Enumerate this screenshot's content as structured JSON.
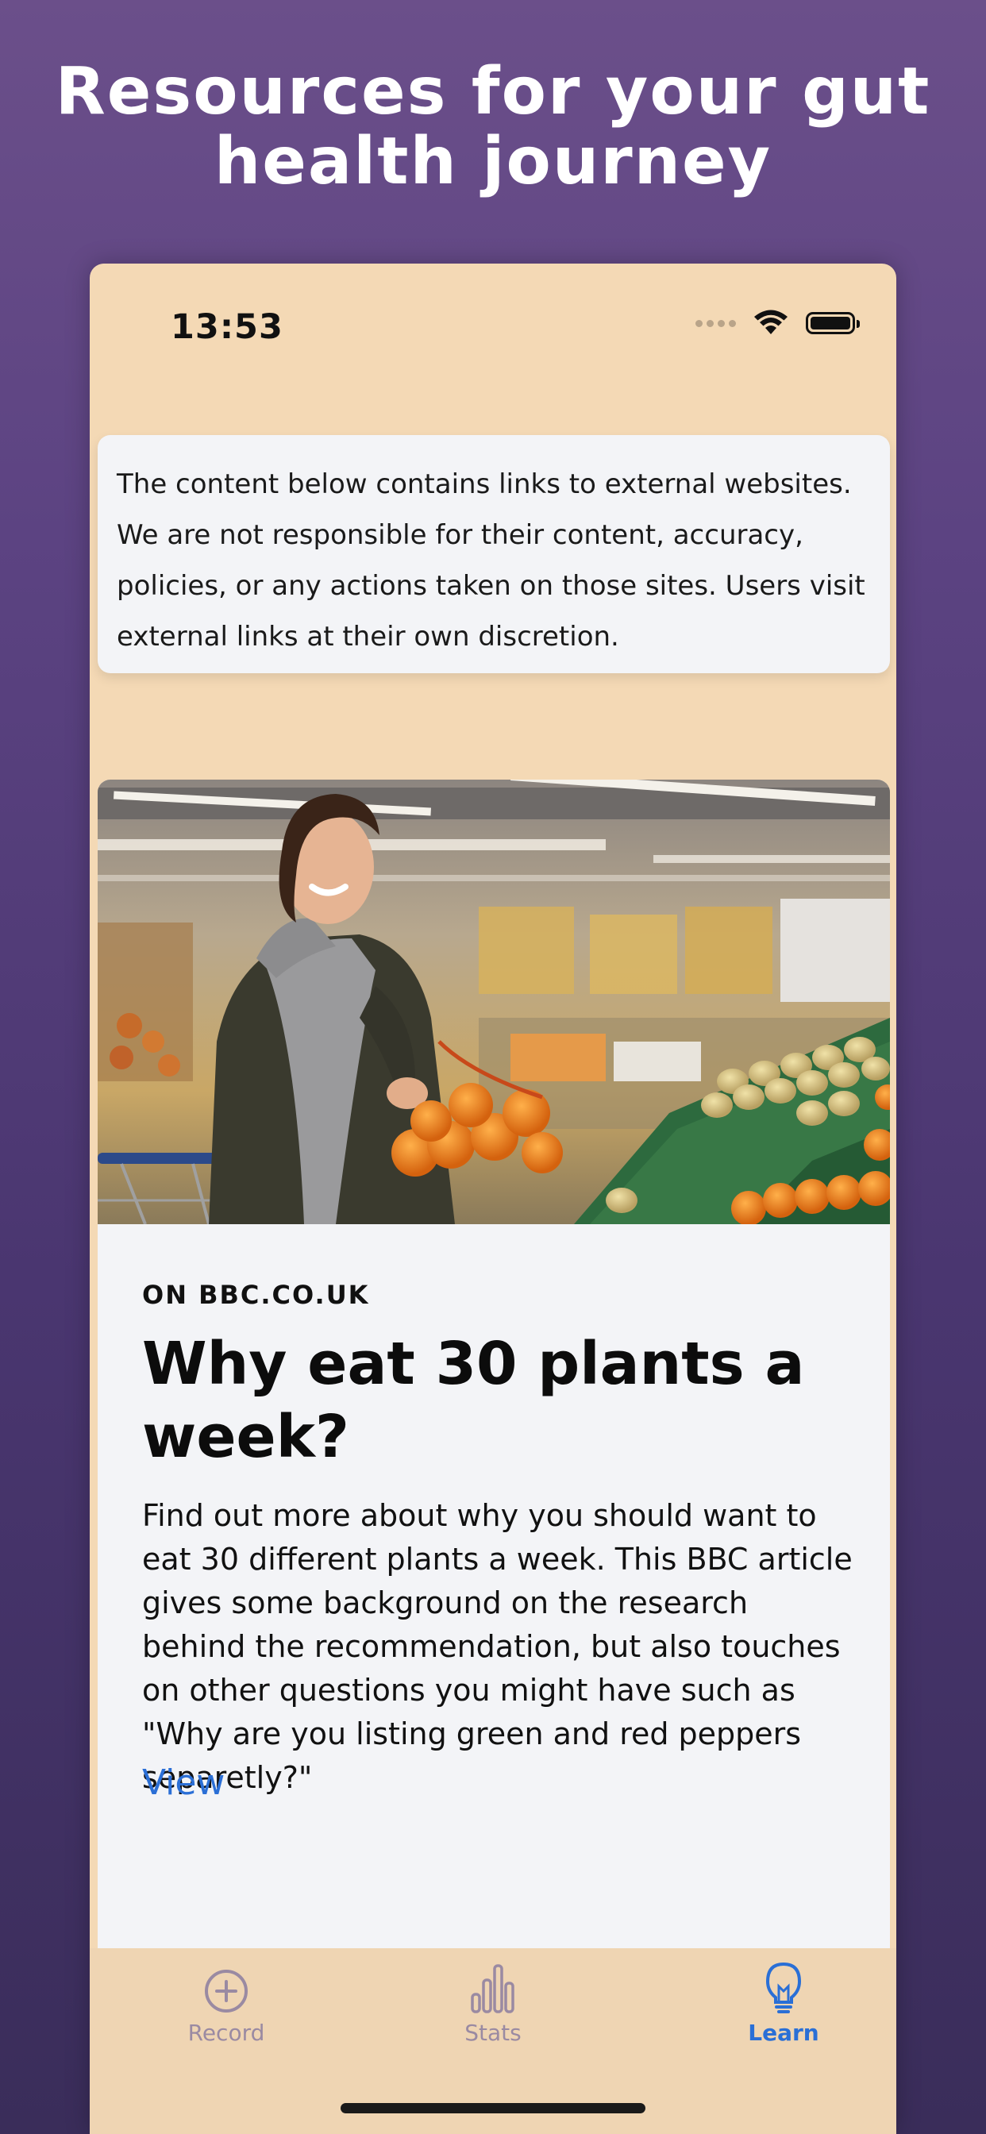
{
  "headline": {
    "line1": "Resources for your gut",
    "line2": "health journey"
  },
  "status_bar": {
    "time": "13:53"
  },
  "disclaimer": {
    "text": "The content below contains links to external websites. We are not responsible for their content, accuracy, policies, or any actions taken on those sites. Users visit external links at their own discretion."
  },
  "article": {
    "source": "ON BBC.CO.UK",
    "title": "Why eat 30 plants a week?",
    "description": "Find out more about why you should want to eat 30 different plants a week. This BBC article gives some background on the research behind the recommendation, but also touches on other questions you might have such as \"Why are you listing green and red peppers separetly?\"",
    "link_label": "View",
    "image_icon": "woman-shopping-vegetables-photo"
  },
  "tabbar": {
    "tabs": [
      {
        "label": "Record",
        "icon": "plus-circle-icon",
        "active": false
      },
      {
        "label": "Stats",
        "icon": "bar-chart-icon",
        "active": false
      },
      {
        "label": "Learn",
        "icon": "lightbulb-icon",
        "active": true
      }
    ]
  },
  "colors": {
    "background": "#5c4382",
    "phone_bg": "#f4d9b5",
    "card_bg": "#f3f4f7",
    "accent": "#2a6fd6",
    "inactive_tab": "#9a8aa2"
  }
}
